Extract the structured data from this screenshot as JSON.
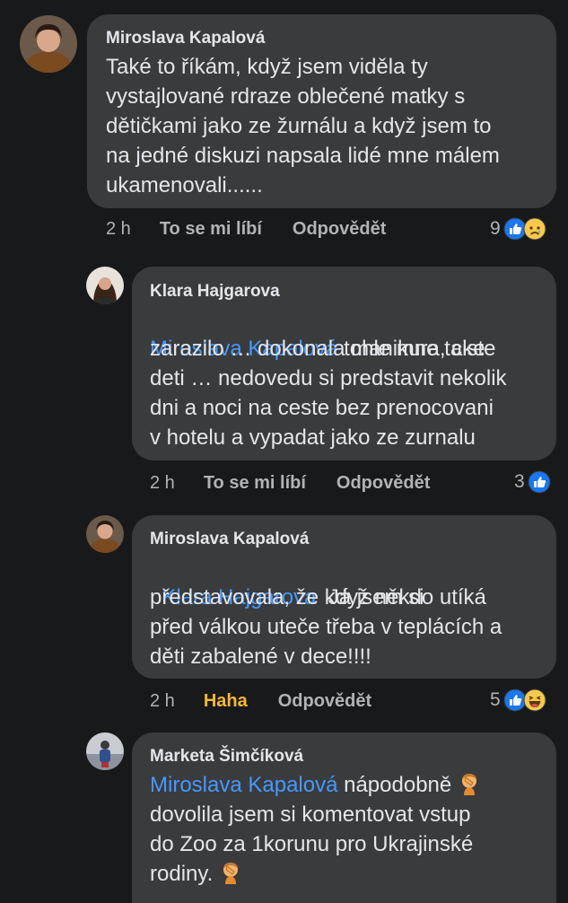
{
  "comments": [
    {
      "author": "Miroslava Kapalová",
      "text_lines": "Také to říkám, když jsem viděla ty\nvystajlované rdraze oblečené matky s\ndětičkami jako ze žurnálu a když jsem to\nna jedné diskuzi napsala lidé mne málem\nukamenovali......",
      "time": "2 h",
      "like_label": "To se mi líbí",
      "reply_label": "Odpovědět",
      "reaction_count": "9",
      "reaction_icons": [
        "like-icon",
        "sad-icon"
      ]
    },
    {
      "author": "Klara Hajgarova",
      "mention": "Miroslava Kapalová",
      "text_after_mention": " tohle mne take",
      "text_lines": "zarazilo … dokonala manikura, ciste\ndeti … nedovedu si predstavit nekolik\ndni a noci na ceste bez prenocovani\nv hotelu a vypadat jako ze zurnalu",
      "time": "2 h",
      "like_label": "To se mi líbí",
      "reply_label": "Odpovědět",
      "reaction_count": "3",
      "reaction_icons": [
        "like-icon"
      ]
    },
    {
      "author": "Miroslava Kapalová",
      "mention": "Klara Hajgarova",
      "text_after_mention": "  Já jsem si",
      "text_lines": "představovala, že když někdo utíká\npřed válkou uteče třeba v teplácích a\nděti zabalené v dece!!!!",
      "time": "2 h",
      "like_label": "Haha",
      "reply_label": "Odpovědět",
      "reaction_count": "5",
      "reaction_icons": [
        "like-icon",
        "haha-icon"
      ]
    },
    {
      "author": "Marketa Šimčíková",
      "mention": "Miroslava Kapalová",
      "text_after_mention": " nápodobně ",
      "text_line2": "dovolila jsem si komentovat vstup",
      "text_line3": "do Zoo za 1korunu pro Ukrajinské",
      "text_line4": "rodiny. ",
      "inline_emoji": "facepalm-emoji"
    }
  ],
  "colors": {
    "background": "#18191a",
    "bubble": "#3a3b3c",
    "mention": "#4599ff",
    "meta": "#b0b3b8",
    "haha": "#f7b928",
    "like_blue": "#1877f2"
  }
}
